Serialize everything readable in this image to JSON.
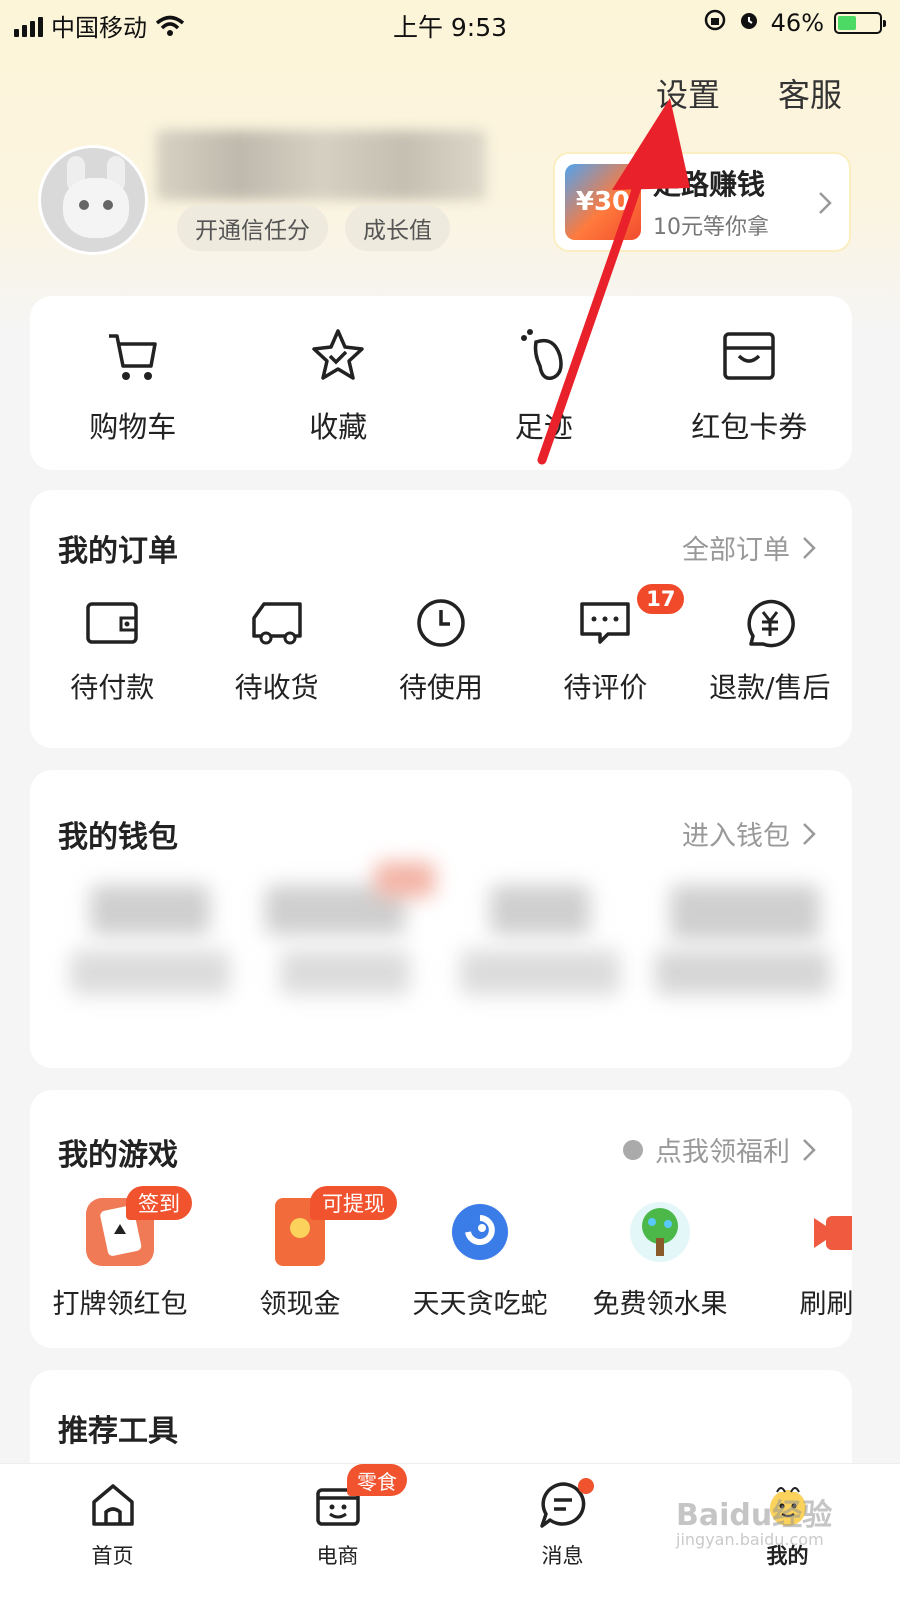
{
  "status_bar": {
    "carrier": "中国移动",
    "time": "上午 9:53",
    "battery": "46%",
    "battery_level": 0.46
  },
  "header": {
    "settings_label": "设置",
    "service_label": "客服",
    "chips": [
      "开通信任分",
      "成长值"
    ],
    "promo": {
      "title": "走路赚钱",
      "subtitle": "10元等你拿",
      "amount": "¥30"
    }
  },
  "quick_links": [
    {
      "label": "购物车",
      "icon": "cart-icon"
    },
    {
      "label": "收藏",
      "icon": "star-icon"
    },
    {
      "label": "足迹",
      "icon": "footprint-icon"
    },
    {
      "label": "红包卡券",
      "icon": "coupon-icon"
    }
  ],
  "orders": {
    "title": "我的订单",
    "link": "全部订单",
    "items": [
      {
        "label": "待付款",
        "icon": "wallet-icon"
      },
      {
        "label": "待收货",
        "icon": "truck-icon"
      },
      {
        "label": "待使用",
        "icon": "clock-icon"
      },
      {
        "label": "待评价",
        "icon": "comment-icon",
        "badge": "17"
      },
      {
        "label": "退款/售后",
        "icon": "refund-icon"
      }
    ]
  },
  "wallet": {
    "title": "我的钱包",
    "link": "进入钱包"
  },
  "games": {
    "title": "我的游戏",
    "link": "点我领福利",
    "items": [
      {
        "label": "打牌领红包",
        "badge": "签到",
        "icon": "card-game-icon"
      },
      {
        "label": "领现金",
        "badge": "可提现",
        "icon": "red-envelope-icon"
      },
      {
        "label": "天天贪吃蛇",
        "icon": "snake-game-icon"
      },
      {
        "label": "免费领水果",
        "icon": "fruit-tree-icon"
      },
      {
        "label": "刷刷就",
        "icon": "video-icon"
      }
    ]
  },
  "tools": {
    "title": "推荐工具"
  },
  "tabbar": [
    {
      "label": "首页",
      "icon": "home-icon"
    },
    {
      "label": "电商",
      "icon": "shop-icon",
      "badge": "零食"
    },
    {
      "label": "消息",
      "icon": "message-icon"
    },
    {
      "label": "我的",
      "icon": "profile-icon",
      "active": true
    }
  ],
  "watermark": {
    "text": "Baidu经验",
    "url": "jingyan.baidu.com"
  },
  "colors": {
    "accent": "#f0532e",
    "header_bg": "#fdf5d8",
    "annotation_arrow": "#e8212a"
  }
}
